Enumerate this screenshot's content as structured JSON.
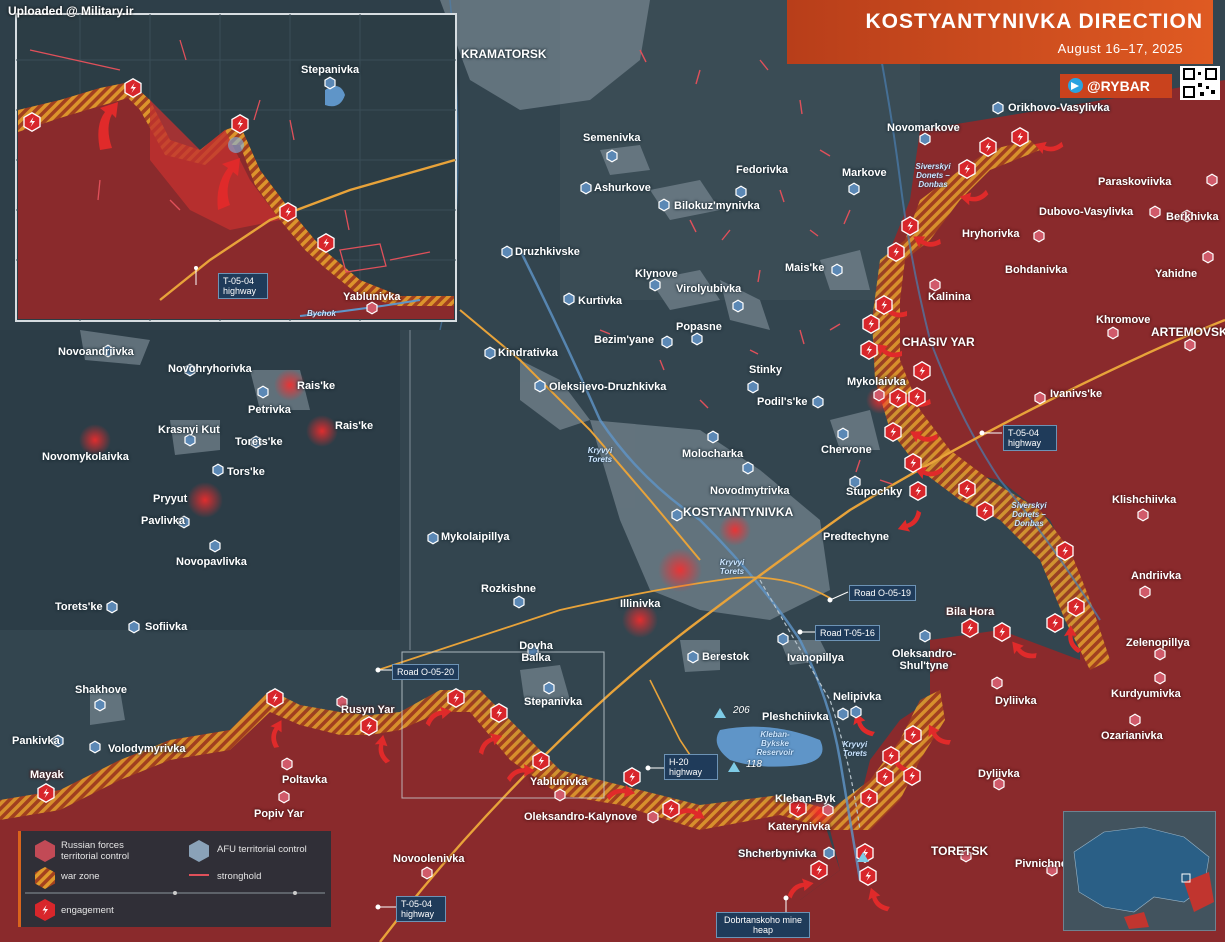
{
  "header": {
    "title": "KOSTYANTYNIVKA DIRECTION",
    "date": "August 16–17, 2025",
    "channel": "@RYBAR",
    "watermark": "Uploaded @ Military.ir"
  },
  "colors": {
    "russian_territory": "#8a2a2c",
    "afu_territory": "#2f434e",
    "war_zone": "#d6892a",
    "engagement": "#d8262b",
    "stronghold": "#e0505a",
    "highway": "#e8a33a",
    "accent": "#d9541f"
  },
  "legend": {
    "russian": "Russian forces territorial control",
    "afu": "AFU territorial control",
    "war_zone": "war zone",
    "stronghold": "stronghold",
    "engagement": "engagement"
  },
  "roads": {
    "t0504_top": "T-05-04 highway",
    "t0504_right": "T-05-04 highway",
    "t0504_bottom": "T-05-04 highway",
    "o0519": "Road O-05-19",
    "t0516": "Road T-05-16",
    "o0520": "Road O-05-20",
    "h20": "H-20 highway",
    "mine": "Dobrtanskoho mine heap"
  },
  "heights": {
    "h206": "206",
    "h118": "118"
  },
  "water": {
    "donets_top": "Siverskyi Donets – Donbas",
    "donets_right": "Siverskyi Donets – Donbas",
    "kryvyi_1": "Kryvyi Torets",
    "kryvyi_2": "Kryvyi Torets",
    "kryvyi_3": "Kryvyi Torets",
    "reservoir": "Kleban-Bykske Reservoir",
    "bychok": "Bychok"
  },
  "inset": {
    "stepanivka": "Stepanivka",
    "yablunivka": "Yablunivka",
    "road": "T-05-04 highway"
  },
  "places": {
    "kramatorsk": "KRAMATORSK",
    "kostyantynivka": "KOSTYANTYNIVKA",
    "chasiv_yar": "CHASIV YAR",
    "artemovsk": "ARTEMOVSK",
    "toretsk": "TORETSK",
    "semenivka": "Semenivka",
    "ashurkove": "Ashurkove",
    "bilokuzmynivka": "Bilokuz'mynivka",
    "fedorivka": "Fedorivka",
    "markove": "Markove",
    "novomarkove": "Novomarkove",
    "orikhovo": "Orikhovo-Vasylivka",
    "paraskoviivka": "Paraskoviivka",
    "dubovo": "Dubovo-Vasylivka",
    "berkhivka": "Berkhivka",
    "hryhorivka": "Hryhorivka",
    "bohdanivka": "Bohdanivka",
    "yahidne": "Yahidne",
    "kalinina": "Kalinina",
    "khromove": "Khromove",
    "druzhkivske": "Druzhkivske",
    "klynove": "Klynove",
    "kurtivka": "Kurtivka",
    "virolyubivka": "Virolyubivka",
    "maiske": "Mais'ke",
    "popasne": "Popasne",
    "bezimyane": "Bezim'yane",
    "kindrativka": "Kindrativka",
    "oleksijevo": "Oleksijevo-Druzhkivka",
    "stinky": "Stinky",
    "podilske": "Podil's'ke",
    "mykolaivka": "Mykolaivka",
    "ivanivske": "Ivanivs'ke",
    "chervone": "Chervone",
    "molocharka": "Molocharka",
    "stupochky": "Stupochky",
    "novodmytrivka": "Novodmytrivka",
    "klishchiivka": "Klishchiivka",
    "predtechyne": "Predtechyne",
    "novoandriivka": "Novoandriivka",
    "novohryhorivka": "Novohryhorivka",
    "raiske_1": "Rais'ke",
    "raiske_2": "Rais'ke",
    "petrivka": "Petrivka",
    "krasnyi_kut": "Krasnyi Kut",
    "toretske_1": "Torets'ke",
    "novomykolaivka": "Novomykolaivka",
    "torske": "Tors'ke",
    "pryyut": "Pryyut",
    "pavlivka": "Pavlivka",
    "novopavlivka": "Novopavlivka",
    "mykolaipillya": "Mykolaipillya",
    "toretske_2": "Torets'ke",
    "sofiivka": "Sofiivka",
    "rozkishne": "Rozkishne",
    "illinivka": "Illinivka",
    "dovha_balka": "Dovha Balka",
    "berestok": "Berestok",
    "ivanopillya": "Ivanopillya",
    "bila_hora": "Bila Hora",
    "oleksandro_shultyne": "Oleksandro-Shul'tyne",
    "andriivka": "Andriivka",
    "zelenopillya": "Zelenopillya",
    "kurdyumivka": "Kurdyumivka",
    "ozarianivka": "Ozarianivka",
    "dyliivka_1": "Dyliivka",
    "dyliivka_2": "Dyliivka",
    "nelipivka": "Nelipivka",
    "pleshchiivka": "Pleshchiivka",
    "kleban_byk": "Kleban-Byk",
    "katerynivka": "Katerynivka",
    "shcherbynivka": "Shcherbynivka",
    "pivnichne": "Pivnichne",
    "stepanivka_main": "Stepanivka",
    "yablunivka_main": "Yablunivka",
    "oleksandro_kalynove": "Oleksandro-Kalynove",
    "rusyn_yar": "Rusyn Yar",
    "poltavka": "Poltavka",
    "popiv_yar": "Popiv Yar",
    "shakhove": "Shakhove",
    "pankivka": "Pankivka",
    "volodymyrivka": "Volodymyrivka",
    "mayak": "Mayak",
    "novoolenivka": "Novoolenivka"
  }
}
